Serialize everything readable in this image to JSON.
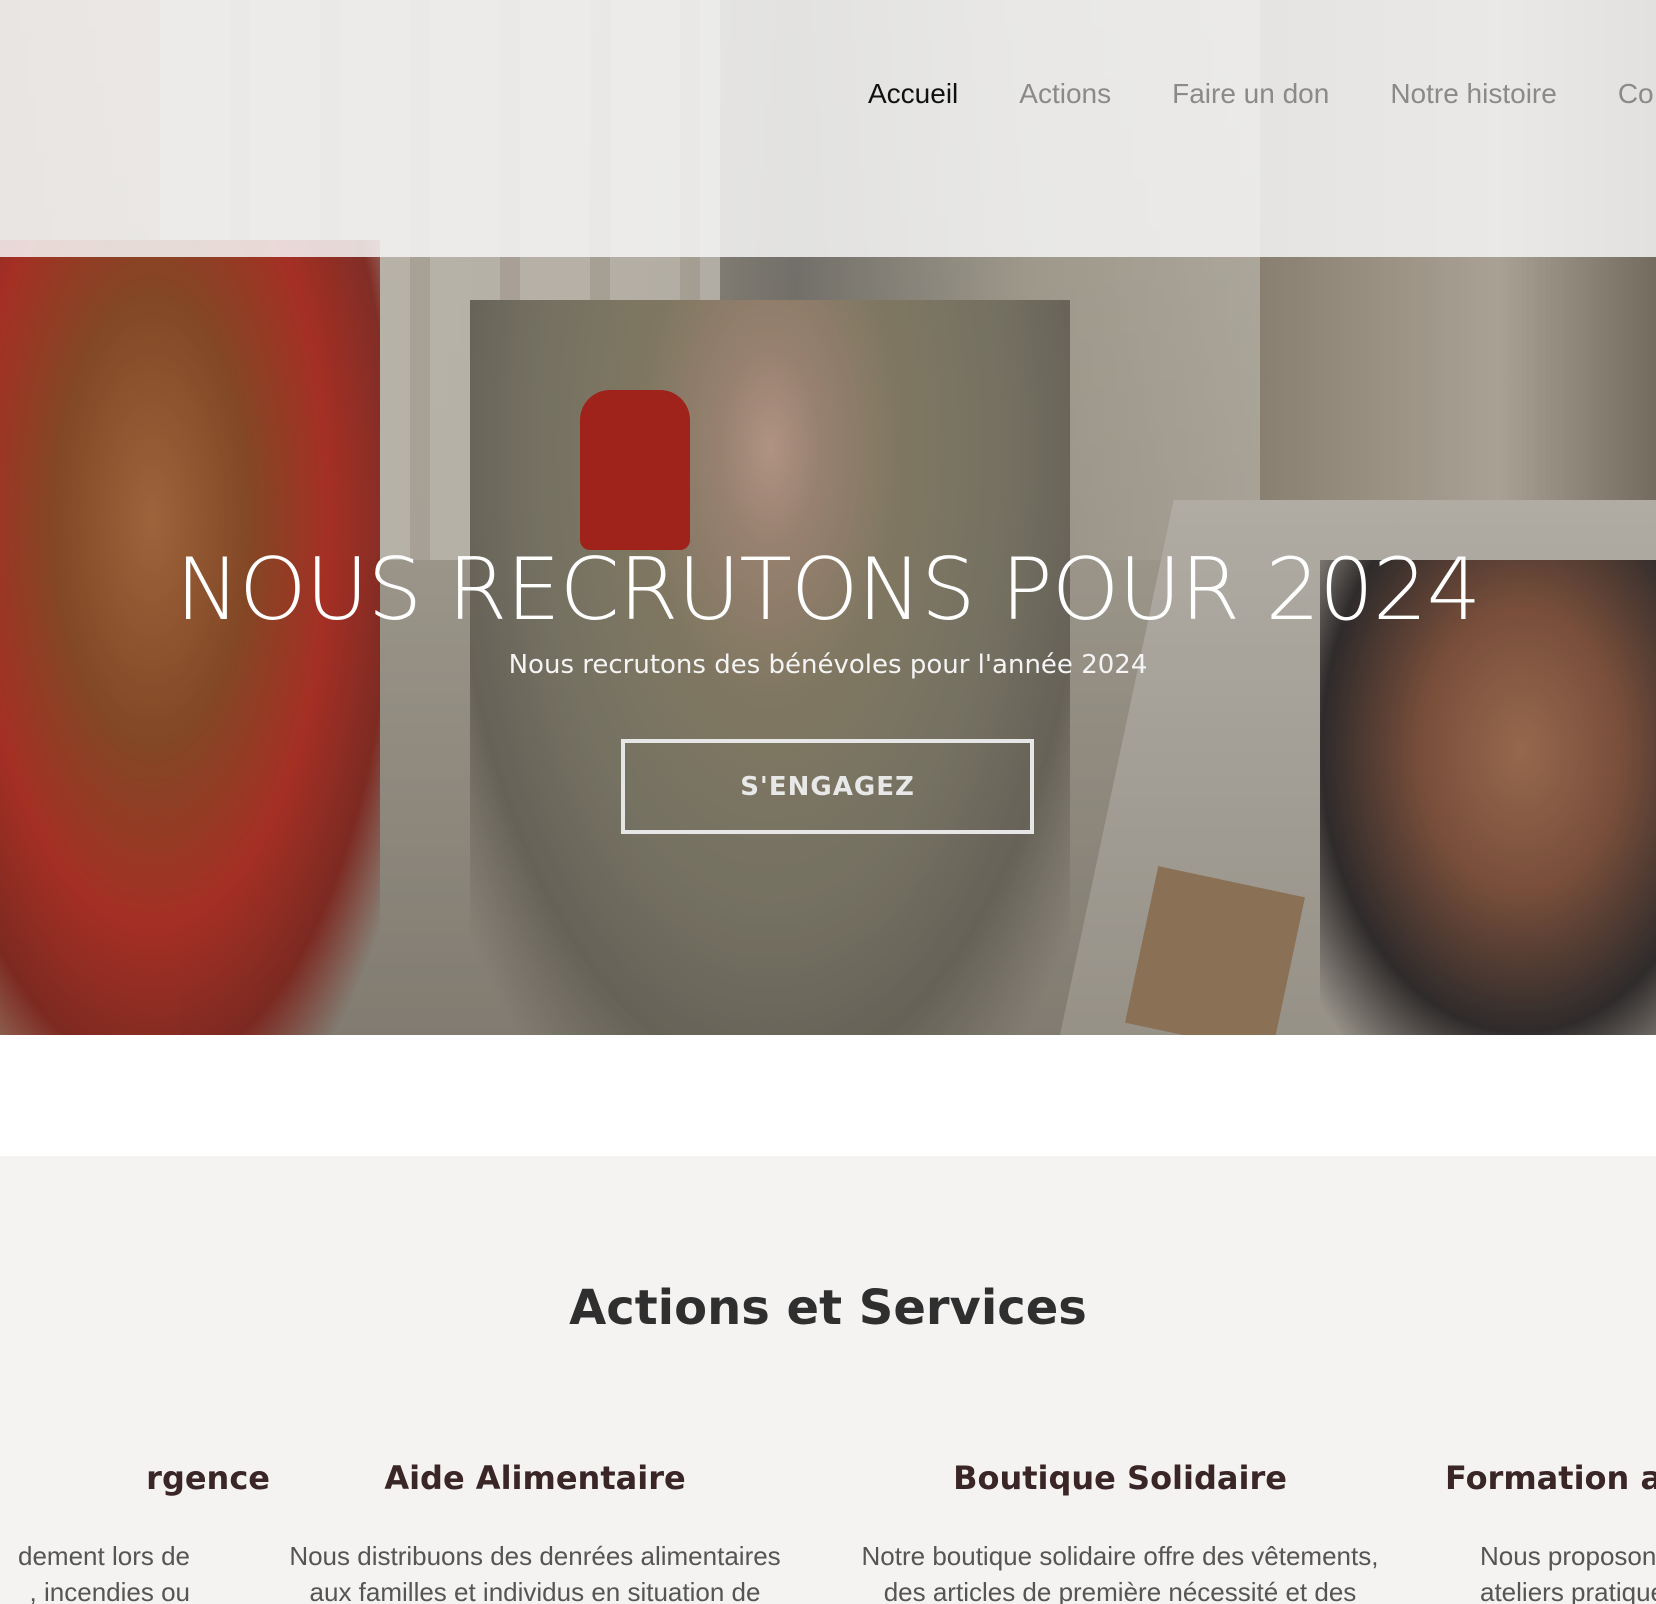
{
  "nav": {
    "items": [
      {
        "label": "Accueil",
        "active": true
      },
      {
        "label": "Actions",
        "active": false
      },
      {
        "label": "Faire un don",
        "active": false
      },
      {
        "label": "Notre histoire",
        "active": false
      },
      {
        "label": "Co",
        "active": false
      }
    ]
  },
  "hero": {
    "title": "NOUS RECRUTONS POUR 2024",
    "subtitle": "Nous recrutons des bénévoles pour l'année 2024",
    "button_label": "S'ENGAGEZ"
  },
  "services": {
    "title": "Actions et Services",
    "items": [
      {
        "title": "rgence",
        "text": "dement lors de\n, incendies ou"
      },
      {
        "title": "Aide Alimentaire",
        "text": "Nous distribuons des denrées alimentaires aux familles et individus en situation de"
      },
      {
        "title": "Boutique Solidaire",
        "text": "Notre boutique solidaire offre des vêtements, des articles de première nécessité et des"
      },
      {
        "title": "Formation au",
        "text": "Nous proposon\nateliers pratiques"
      }
    ]
  },
  "colors": {
    "nav_active": "#111111",
    "nav_inactive": "#8a8a8a",
    "services_bg": "#f4f3f1",
    "service_title": "#3a2626"
  }
}
